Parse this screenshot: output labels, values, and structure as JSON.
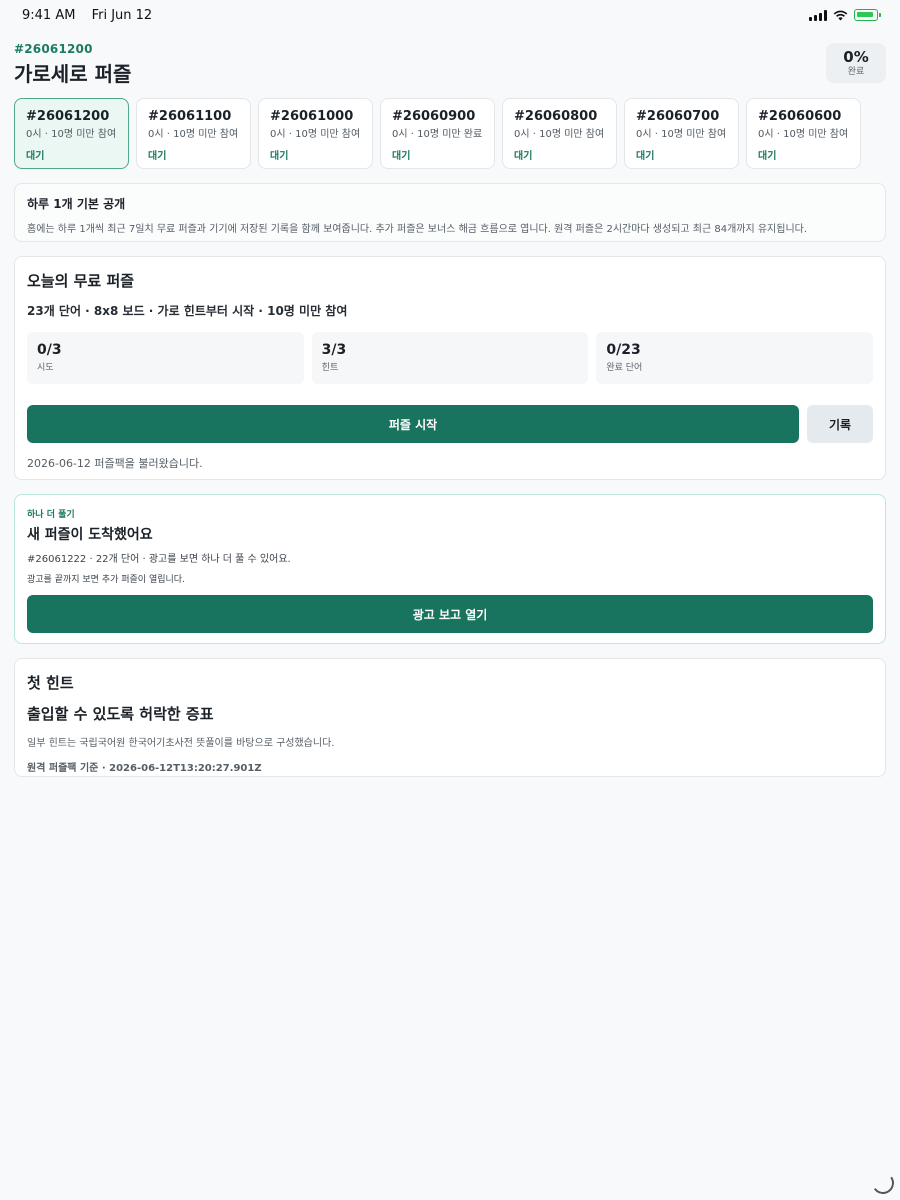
{
  "status_bar": {
    "time": "9:41 AM",
    "date": "Fri Jun 12"
  },
  "header": {
    "puzzle_id": "#26061200",
    "title": "가로세로 퍼즐",
    "progress_value": "0%",
    "progress_label": "완료"
  },
  "tabs": [
    {
      "id": "#26061200",
      "meta": "0시 · 10명 미만 참여",
      "status": "대기"
    },
    {
      "id": "#26061100",
      "meta": "0시 · 10명 미만 참여",
      "status": "대기"
    },
    {
      "id": "#26061000",
      "meta": "0시 · 10명 미만 참여",
      "status": "대기"
    },
    {
      "id": "#26060900",
      "meta": "0시 · 10명 미만 완료",
      "status": "대기"
    },
    {
      "id": "#26060800",
      "meta": "0시 · 10명 미만 참여",
      "status": "대기"
    },
    {
      "id": "#26060700",
      "meta": "0시 · 10명 미만 참여",
      "status": "대기"
    },
    {
      "id": "#26060600",
      "meta": "0시 · 10명 미만 참여",
      "status": "대기"
    }
  ],
  "notice": {
    "title": "하루 1개 기본 공개",
    "body": "홈에는 하루 1개씩 최근 7일치 무료 퍼즐과 기기에 저장된 기록을 함께 보여줍니다. 추가 퍼즐은 보너스 해금 흐름으로 엽니다. 원격 퍼즐은 2시간마다 생성되고 최근 84개까지 유지됩니다."
  },
  "today": {
    "title": "오늘의 무료 퍼즐",
    "subtitle": "23개 단어 · 8x8 보드 · 가로 힌트부터 시작 · 10명 미만 참여",
    "stats": [
      {
        "value": "0/3",
        "label": "시도"
      },
      {
        "value": "3/3",
        "label": "힌트"
      },
      {
        "value": "0/23",
        "label": "완료 단어"
      }
    ],
    "start_label": "퍼즐 시작",
    "records_label": "기록",
    "loaded_text": "2026-06-12 퍼즐팩을 불러왔습니다."
  },
  "bonus": {
    "eyebrow": "하나 더 풀기",
    "title": "새 퍼즐이 도착했어요",
    "meta": "#26061222 · 22개 단어 · 광고를 보면 하나 더 풀 수 있어요.",
    "note": "광고를 끝까지 보면 추가 퍼즐이 열립니다.",
    "button_label": "광고 보고 열기"
  },
  "hint": {
    "title": "첫 힌트",
    "answer_clue": "출입할 수 있도록 허락한 증표",
    "source": "일부 힌트는 국립국어원 한국어기초사전 뜻풀이를 바탕으로 구성했습니다.",
    "reference": "원격 퍼즐팩 기준 · 2026-06-12T13:20:27.901Z"
  },
  "colors": {
    "accent": "#19745f",
    "accent_text": "#1d7a63",
    "background": "#f7f9fa"
  }
}
